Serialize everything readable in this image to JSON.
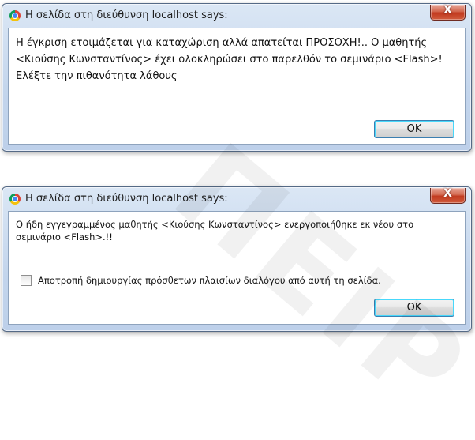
{
  "dialogs": [
    {
      "title": "Η σελίδα στη διεύθυνση localhost says:",
      "close_label": "X",
      "message": "Η έγκριση ετοιμάζεται για καταχώριση αλλά απατείται ΠΡΟΣΟΧΗ!.. Ο μαθητής <Κιούσης Κωνσταντίνος> έχει ολοκληρώσει στο παρελθόν το σεμινάριο <Flash>! Ελέξτε την πιθανότητα λάθους",
      "ok_label": "OK"
    },
    {
      "title": "Η σελίδα στη διεύθυνση localhost says:",
      "close_label": "X",
      "message": "Ο ήδη εγγεγραμμένος μαθητής <Κιούσης Κωνσταντίνος> ενεργοποιήθηκε εκ νέου στο σεμινάριο <Flash>.!!",
      "checkbox_label": "Αποτροπή δημιουργίας πρόσθετων πλαισίων διαλόγου από αυτή τη σελίδα.",
      "checkbox_checked": false,
      "ok_label": "OK"
    }
  ],
  "icons": {
    "browser": "chrome-icon",
    "close": "close-icon"
  },
  "colors": {
    "close_button": "#c1391e",
    "title_bar": "#c3d5ec"
  }
}
